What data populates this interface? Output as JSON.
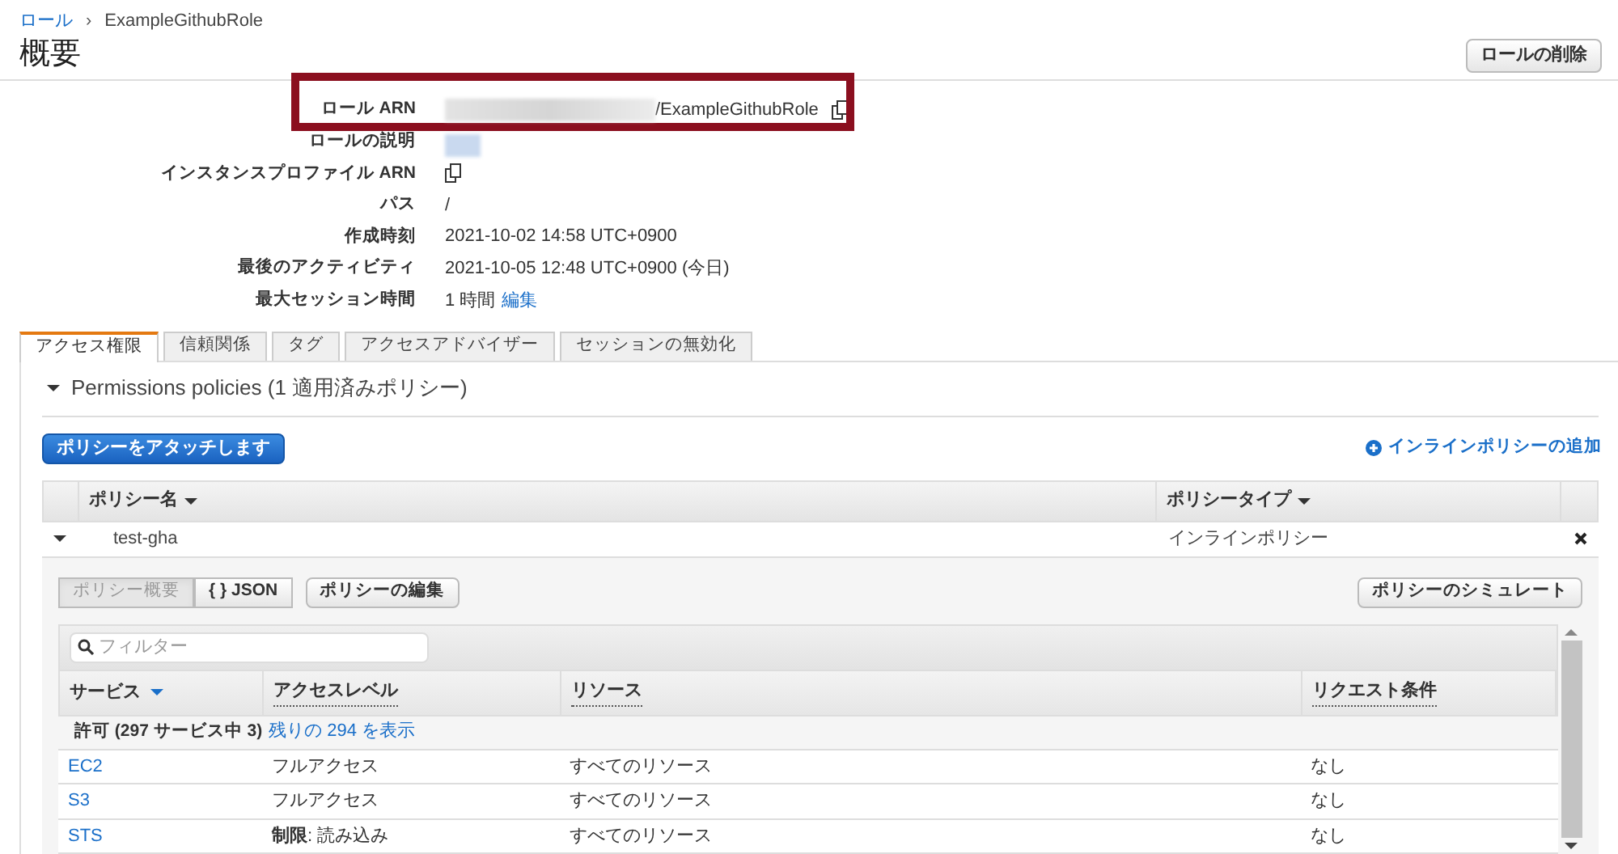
{
  "breadcrumb": [
    {
      "label": "ロール",
      "link": true
    },
    {
      "label": "ExampleGithubRole",
      "link": false
    }
  ],
  "breadcrumb_separator": "›",
  "title": "概要",
  "delete_button": "ロールの削除",
  "summary": [
    {
      "label": "ロール ARN",
      "kind": "arn",
      "value": "/ExampleGithubRole",
      "highlighted": true
    },
    {
      "label": "ロールの説明",
      "kind": "redacted",
      "highlighted": false
    },
    {
      "label": "インスタンスプロファイル ARN",
      "kind": "copy",
      "highlighted": false
    },
    {
      "label": "パス",
      "kind": "text",
      "value": "/",
      "highlighted": false
    },
    {
      "label": "作成時刻",
      "kind": "text",
      "value": "2021-10-02 14:58 UTC+0900",
      "highlighted": false
    },
    {
      "label": "最後のアクティビティ",
      "kind": "text",
      "value": "2021-10-05 12:48 UTC+0900 (今日)",
      "highlighted": false
    },
    {
      "label": "最大セッション時間",
      "kind": "text_link",
      "value": "1 時間",
      "link": "編集",
      "highlighted": false
    }
  ],
  "tabs": [
    {
      "label": "アクセス権限",
      "selected": true
    },
    {
      "label": "信頼関係",
      "selected": false
    },
    {
      "label": "タグ",
      "selected": false
    },
    {
      "label": "アクセスアドバイザー",
      "selected": false
    },
    {
      "label": "セッションの無効化",
      "selected": false
    }
  ],
  "permissions": {
    "title": "Permissions policies (1 適用済みポリシー)",
    "expanded": true,
    "attach_button": "ポリシーをアタッチします",
    "add_inline": "インラインポリシーの追加",
    "columns": [
      "ポリシー名",
      "ポリシータイプ"
    ],
    "rows": [
      {
        "name": "test-gha",
        "type": "インラインポリシー",
        "expanded": true
      }
    ]
  },
  "policy_detail": {
    "view_buttons": [
      {
        "label": "ポリシー概要",
        "selected": true
      },
      {
        "label": "{ } JSON",
        "selected": false
      }
    ],
    "edit_button": "ポリシーの編集",
    "simulate_button": "ポリシーのシミュレート",
    "filter": {
      "placeholder": "フィルター"
    },
    "columns": [
      "サービス",
      "アクセスレベル",
      "リソース",
      "リクエスト条件"
    ],
    "group": {
      "text": "許可 (297 サービス中 3)",
      "link": "残りの 294 を表示"
    },
    "rows": [
      {
        "service": "EC2",
        "access_level": "フルアクセス",
        "resource": "すべてのリソース",
        "condition": "なし"
      },
      {
        "service": "S3",
        "access_level": "フルアクセス",
        "resource": "すべてのリソース",
        "condition": "なし"
      },
      {
        "service": "STS",
        "access_level": "**制限**: 読み込み",
        "resource": "すべてのリソース",
        "condition": "なし"
      }
    ]
  }
}
